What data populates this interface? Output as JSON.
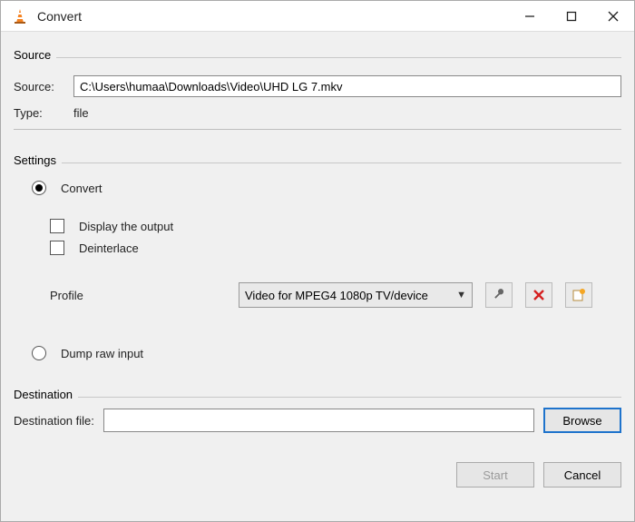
{
  "window": {
    "title": "Convert"
  },
  "source": {
    "group_label": "Source",
    "source_label": "Source:",
    "source_value": "C:\\Users\\humaa\\Downloads\\Video\\UHD LG 7.mkv",
    "type_label": "Type:",
    "type_value": "file"
  },
  "settings": {
    "group_label": "Settings",
    "convert_label": "Convert",
    "display_output_label": "Display the output",
    "deinterlace_label": "Deinterlace",
    "profile_label": "Profile",
    "profile_value": "Video for MPEG4 1080p TV/device",
    "dump_raw_label": "Dump raw input"
  },
  "destination": {
    "group_label": "Destination",
    "file_label": "Destination file:",
    "file_value": "",
    "browse_label": "Browse"
  },
  "footer": {
    "start_label": "Start",
    "cancel_label": "Cancel"
  }
}
